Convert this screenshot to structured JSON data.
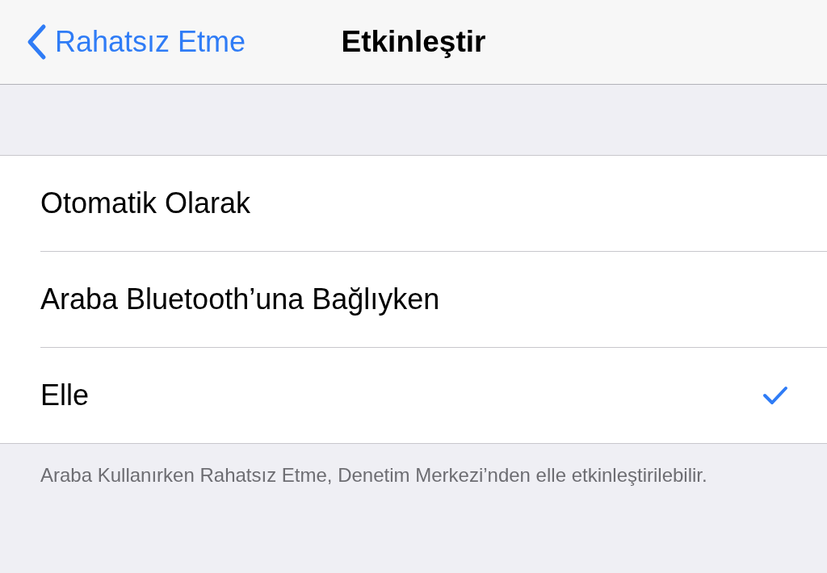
{
  "nav_bar": {
    "back_label": "Rahatsız Etme",
    "title": "Etkinleştir"
  },
  "options": [
    {
      "label": "Otomatik Olarak",
      "selected": false
    },
    {
      "label": "Araba Bluetooth’una Bağlıyken",
      "selected": false
    },
    {
      "label": "Elle",
      "selected": true
    }
  ],
  "footer": "Araba Kullanırken Rahatsız Etme, Denetim Merkezi’nden elle etkinleştirilebilir."
}
